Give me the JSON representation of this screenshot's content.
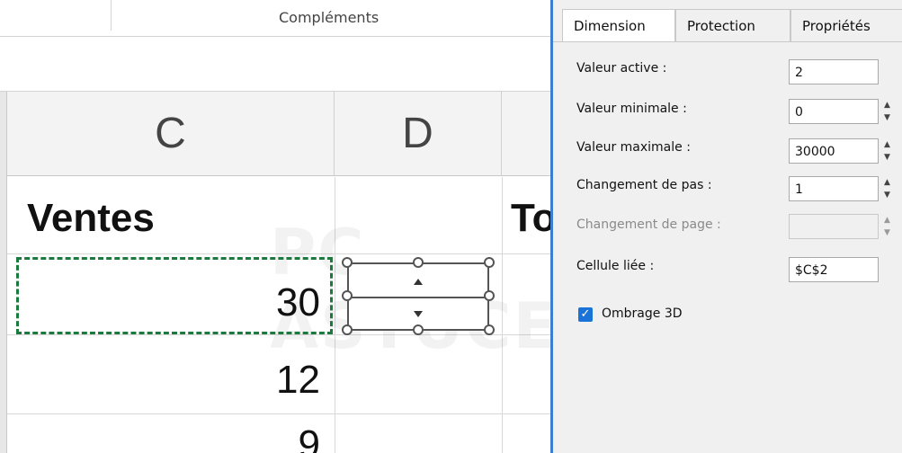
{
  "ribbon": {
    "group_label": "Compléments"
  },
  "columns": {
    "c": "C",
    "d": "D"
  },
  "cells": {
    "header_c": "Ventes",
    "header_e": "To",
    "values": [
      "30",
      "12",
      "9"
    ]
  },
  "dialog": {
    "tabs": [
      "Dimension",
      "Protection",
      "Propriétés"
    ],
    "fields": {
      "valeur_active": {
        "label": "Valeur active :",
        "value": "2"
      },
      "valeur_minimale": {
        "label": "Valeur minimale :",
        "value": "0"
      },
      "valeur_maximale": {
        "label": "Valeur maximale :",
        "value": "30000"
      },
      "changement_pas": {
        "label": "Changement de pas :",
        "value": "1"
      },
      "changement_page": {
        "label": "Changement de page :",
        "value": ""
      },
      "cellule_liee": {
        "label": "Cellule liée :",
        "value": "$C$2"
      }
    },
    "ombrage": {
      "label": "Ombrage 3D",
      "checked": true
    }
  },
  "colors": {
    "accent": "#1a73d6",
    "selection": "#1d7a3f",
    "dialog_border": "#3c7fd0"
  },
  "icons": {
    "spinner": "spin-arrows-icon",
    "checkbox": "checkmark-icon"
  }
}
